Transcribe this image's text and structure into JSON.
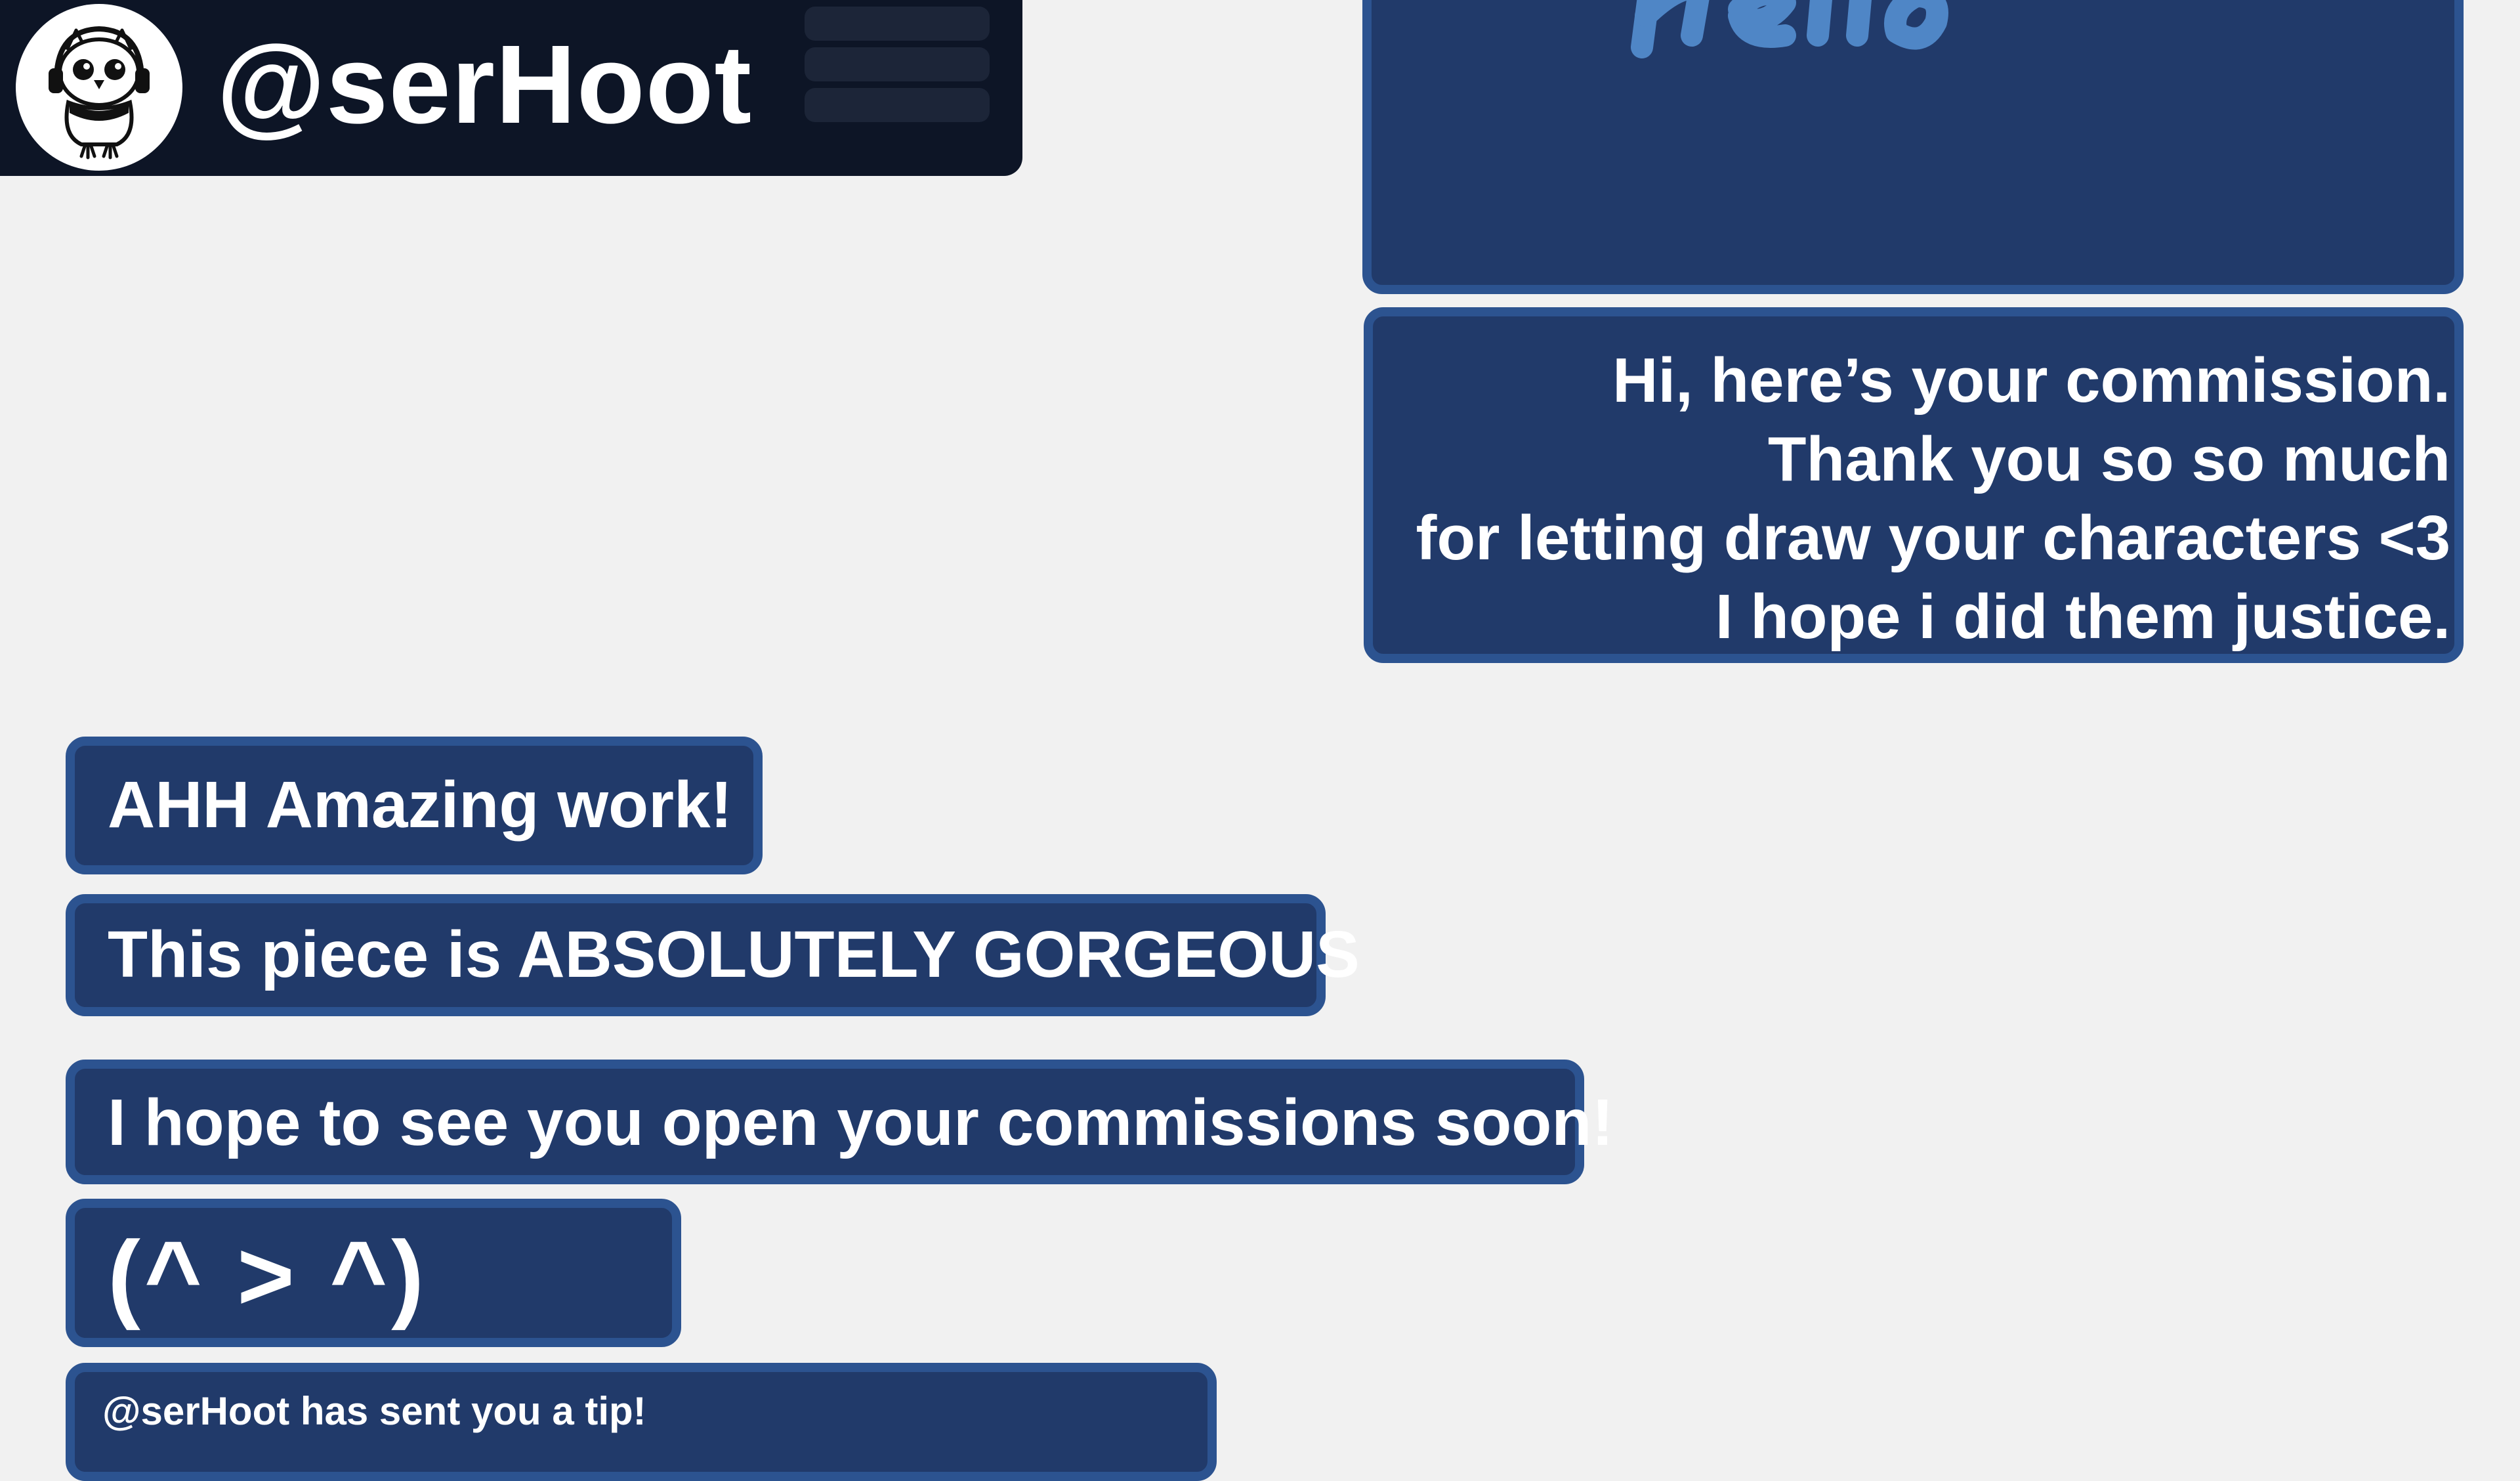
{
  "header": {
    "username": "@serHoot",
    "avatar_icon": "owl-avatar-icon",
    "menu_icon": "menu-icon"
  },
  "colors": {
    "header_bg": "#0d1526",
    "page_bg": "#f1f1f1",
    "bubble_fill": "#213a6a",
    "bubble_border": "#2c5390",
    "image_text_color": "#4f86c6"
  },
  "messages": {
    "sent_image": {
      "kind": "image",
      "caption_partial": "Hello"
    },
    "sent_text": {
      "lines": [
        "Hi, here’s your commission.",
        "Thank you so so much",
        "for letting draw your characters <3",
        "I hope i did them justice."
      ]
    },
    "received": [
      {
        "text": "AHH Amazing work!"
      },
      {
        "text": "This piece is ABSOLUTELY GORGEOUS"
      },
      {
        "text": "I hope to see you open your commissions soon!"
      },
      {
        "text": "(^ > ^)"
      },
      {
        "text": "@serHoot has sent you a tip!"
      }
    ]
  }
}
